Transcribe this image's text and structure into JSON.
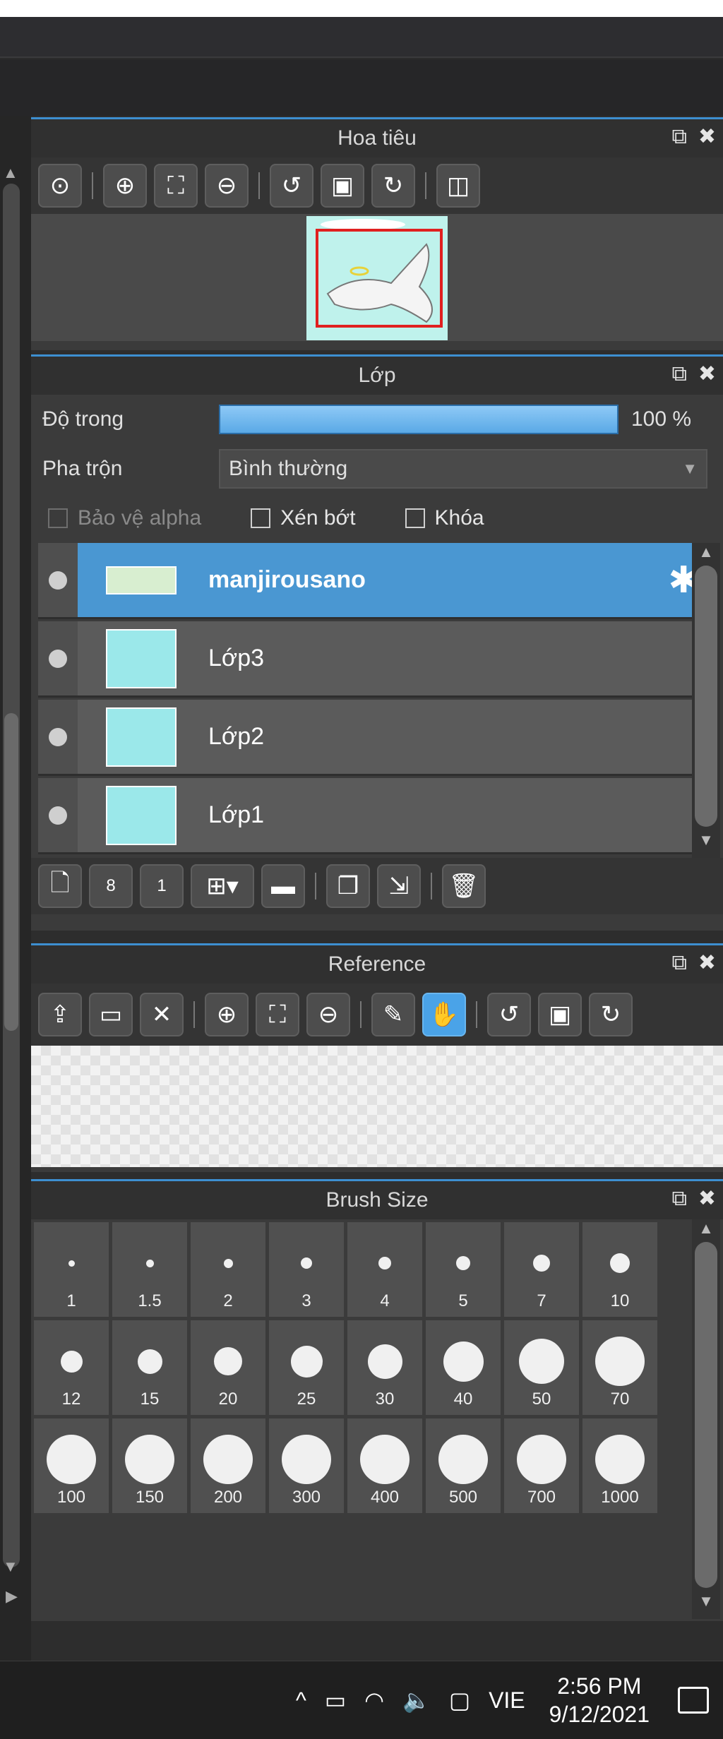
{
  "navigator": {
    "title": "Hoa tiêu",
    "toolbar": [
      "zoom-actual-icon",
      "zoom-in-icon",
      "fit-screen-icon",
      "zoom-out-icon",
      "rotate-left-icon",
      "fit-window-icon",
      "rotate-right-icon",
      "flip-icon"
    ]
  },
  "layers": {
    "title": "Lớp",
    "opacity_label": "Độ trong",
    "opacity_value": "100 %",
    "opacity_fraction": 1.0,
    "blend_label": "Pha trộn",
    "blend_value": "Bình thường",
    "protect_alpha": "Bảo vệ alpha",
    "clipping": "Xén bớt",
    "lock": "Khóa",
    "items": [
      {
        "name": "manjirousano",
        "selected": true
      },
      {
        "name": "Lớp3",
        "selected": false
      },
      {
        "name": "Lớp2",
        "selected": false
      },
      {
        "name": "Lớp1",
        "selected": false
      }
    ],
    "toolbar": [
      "new-layer-icon",
      "new-8bit-layer-icon",
      "new-1bit-layer-icon",
      "add-layer-dropdown-icon",
      "folder-icon",
      "duplicate-icon",
      "merge-down-icon",
      "delete-icon"
    ]
  },
  "reference": {
    "title": "Reference",
    "toolbar": [
      "upload-icon",
      "open-folder-icon",
      "close-icon",
      "zoom-in-icon",
      "fit-screen-icon",
      "zoom-out-icon",
      "eyedropper-icon",
      "hand-icon",
      "rotate-left-icon",
      "fit-window-icon",
      "rotate-right-icon"
    ]
  },
  "brush_size": {
    "title": "Brush Size",
    "sizes": [
      "1",
      "1.5",
      "2",
      "3",
      "4",
      "5",
      "7",
      "10",
      "12",
      "15",
      "20",
      "25",
      "30",
      "40",
      "50",
      "70",
      "100",
      "150",
      "200",
      "300",
      "400",
      "500",
      "700",
      "1000"
    ]
  },
  "taskbar": {
    "language": "VIE",
    "time": "2:56 PM",
    "date": "9/12/2021",
    "icons": [
      "chevron-up-icon",
      "battery-icon",
      "wifi-icon",
      "volume-icon",
      "meet-now-icon"
    ]
  },
  "colors": {
    "accent": "#3d8fd1",
    "selected_layer": "#4a97d2",
    "panel_bg": "#3b3b3b"
  }
}
